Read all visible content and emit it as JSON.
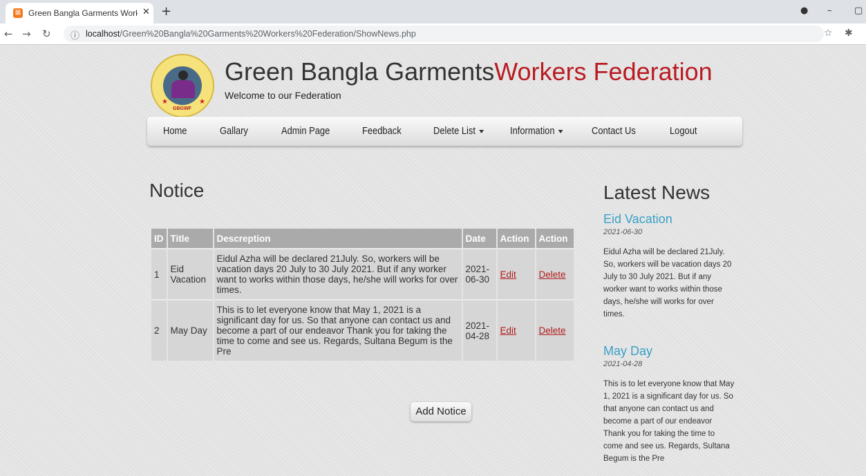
{
  "browser": {
    "tab_title": "Green Bangla Garments Workers",
    "tab_favicon": "xampp-icon",
    "url_host": "localhost",
    "url_path": "/Green%20Bangla%20Garments%20Workers%20Federation/ShowNews.php"
  },
  "site": {
    "title_main": "Green Bangla Garments",
    "title_accent": "Workers Federation",
    "subtitle": "Welcome to our Federation",
    "logo_text": "GBGWF",
    "accent_color": "#b81c22"
  },
  "nav": {
    "items": [
      "Home",
      "Gallary",
      "Admin Page",
      "Feedback",
      "Delete List",
      "Information",
      "Contact Us",
      "Logout"
    ]
  },
  "notice": {
    "heading": "Notice",
    "columns": [
      "ID",
      "Title",
      "Descreption",
      "Date",
      "Action",
      "Action"
    ],
    "rows": [
      {
        "id": "1",
        "title": "Eid Vacation",
        "description": "Eidul Azha will be declared 21July. So, workers will be vacation days 20 July to 30 July 2021. But if any worker want to works within those days, he/she will works for over times.",
        "date": "2021-06-30",
        "edit": "Edit",
        "delete": "Delete"
      },
      {
        "id": "2",
        "title": "May Day",
        "description": "This is to let everyone know that May 1, 2021 is a significant day for us. So that anyone can contact us and become a part of our endeavor Thank you for taking the time to come and see us. Regards, Sultana Begum is the Pre",
        "date": "2021-04-28",
        "edit": "Edit",
        "delete": "Delete"
      }
    ],
    "add_button": "Add Notice"
  },
  "news": {
    "heading": "Latest News",
    "items": [
      {
        "title": "Eid Vacation",
        "date": "2021-06-30",
        "body": "Eidul Azha will be declared 21July. So, workers will be vacation days 20 July to 30 July 2021. But if any worker want to works within those days, he/she will works for over times."
      },
      {
        "title": "May Day",
        "date": "2021-04-28",
        "body": "This is to let everyone know that May 1, 2021 is a significant day for us. So that anyone can contact us and become a part of our endeavor Thank you for taking the time to come and see us. Regards, Sultana Begum is the Pre"
      }
    ]
  }
}
